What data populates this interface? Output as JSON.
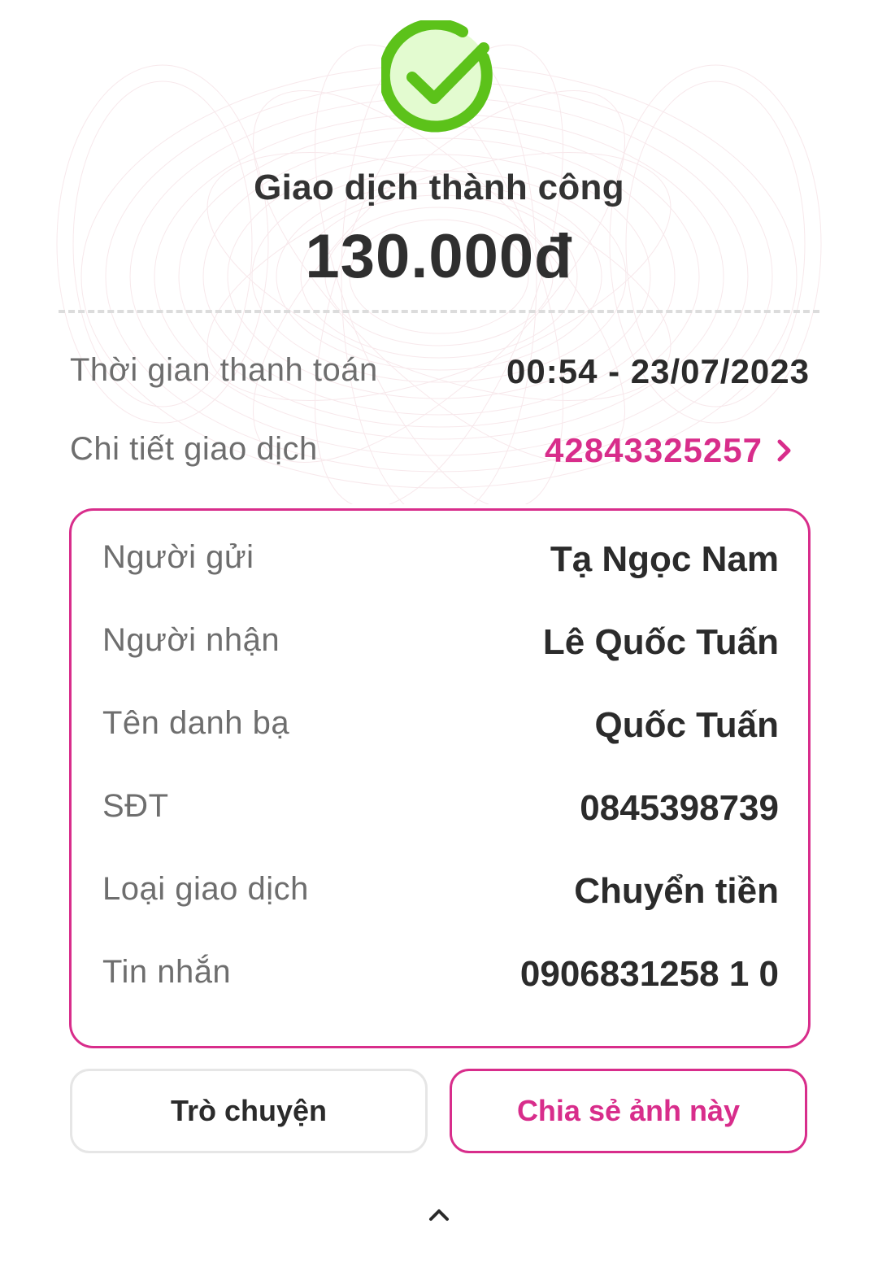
{
  "status": {
    "icon": "check-circle-icon",
    "title": "Giao dịch thành công",
    "amount": "130.000đ"
  },
  "info": {
    "time_label": "Thời gian thanh toán",
    "time_value": "00:54 - 23/07/2023",
    "detail_label": "Chi tiết giao dịch",
    "detail_value": "42843325257"
  },
  "details": {
    "rows": [
      {
        "label": "Người gửi",
        "value": "Tạ Ngọc Nam"
      },
      {
        "label": "Người nhận",
        "value": "Lê Quốc Tuấn"
      },
      {
        "label": "Tên danh bạ",
        "value": "Quốc Tuấn"
      },
      {
        "label": "SĐT",
        "value": "0845398739"
      },
      {
        "label": "Loại giao dịch",
        "value": "Chuyển tiền"
      },
      {
        "label": "Tin nhắn",
        "value": "0906831258 1 0"
      }
    ]
  },
  "actions": {
    "chat_label": "Trò chuyện",
    "share_label": "Chia sẻ ảnh này"
  },
  "colors": {
    "accent": "#d82d8b",
    "success": "#5cc21a",
    "success_fill": "#e3fbd0"
  }
}
